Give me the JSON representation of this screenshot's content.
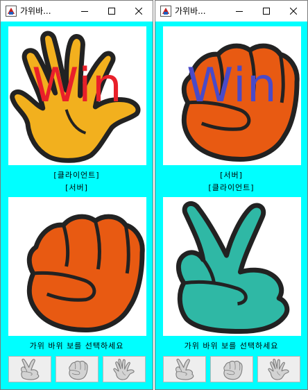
{
  "windows": [
    {
      "title": "가위바...",
      "top_hand": "paper",
      "top_hand_color": "#F2B01E",
      "result_text": "Win",
      "result_color": "#E8202A",
      "label_first": "[클라이언트]",
      "label_second": "[서버]",
      "bottom_hand": "rock",
      "bottom_hand_color": "#E85A12",
      "prompt": "가위 바위 보를 선택하세요",
      "choices": [
        "scissors",
        "rock",
        "paper"
      ]
    },
    {
      "title": "가위바...",
      "top_hand": "rock",
      "top_hand_color": "#E85A12",
      "result_text": "Win",
      "result_color": "#4A4AC8",
      "label_first": "[서버]",
      "label_second": "[클라이언트]",
      "bottom_hand": "scissors",
      "bottom_hand_color": "#2FB8A5",
      "prompt": "가위 바위 보를 선택하세요",
      "choices": [
        "scissors",
        "rock",
        "paper"
      ]
    }
  ]
}
